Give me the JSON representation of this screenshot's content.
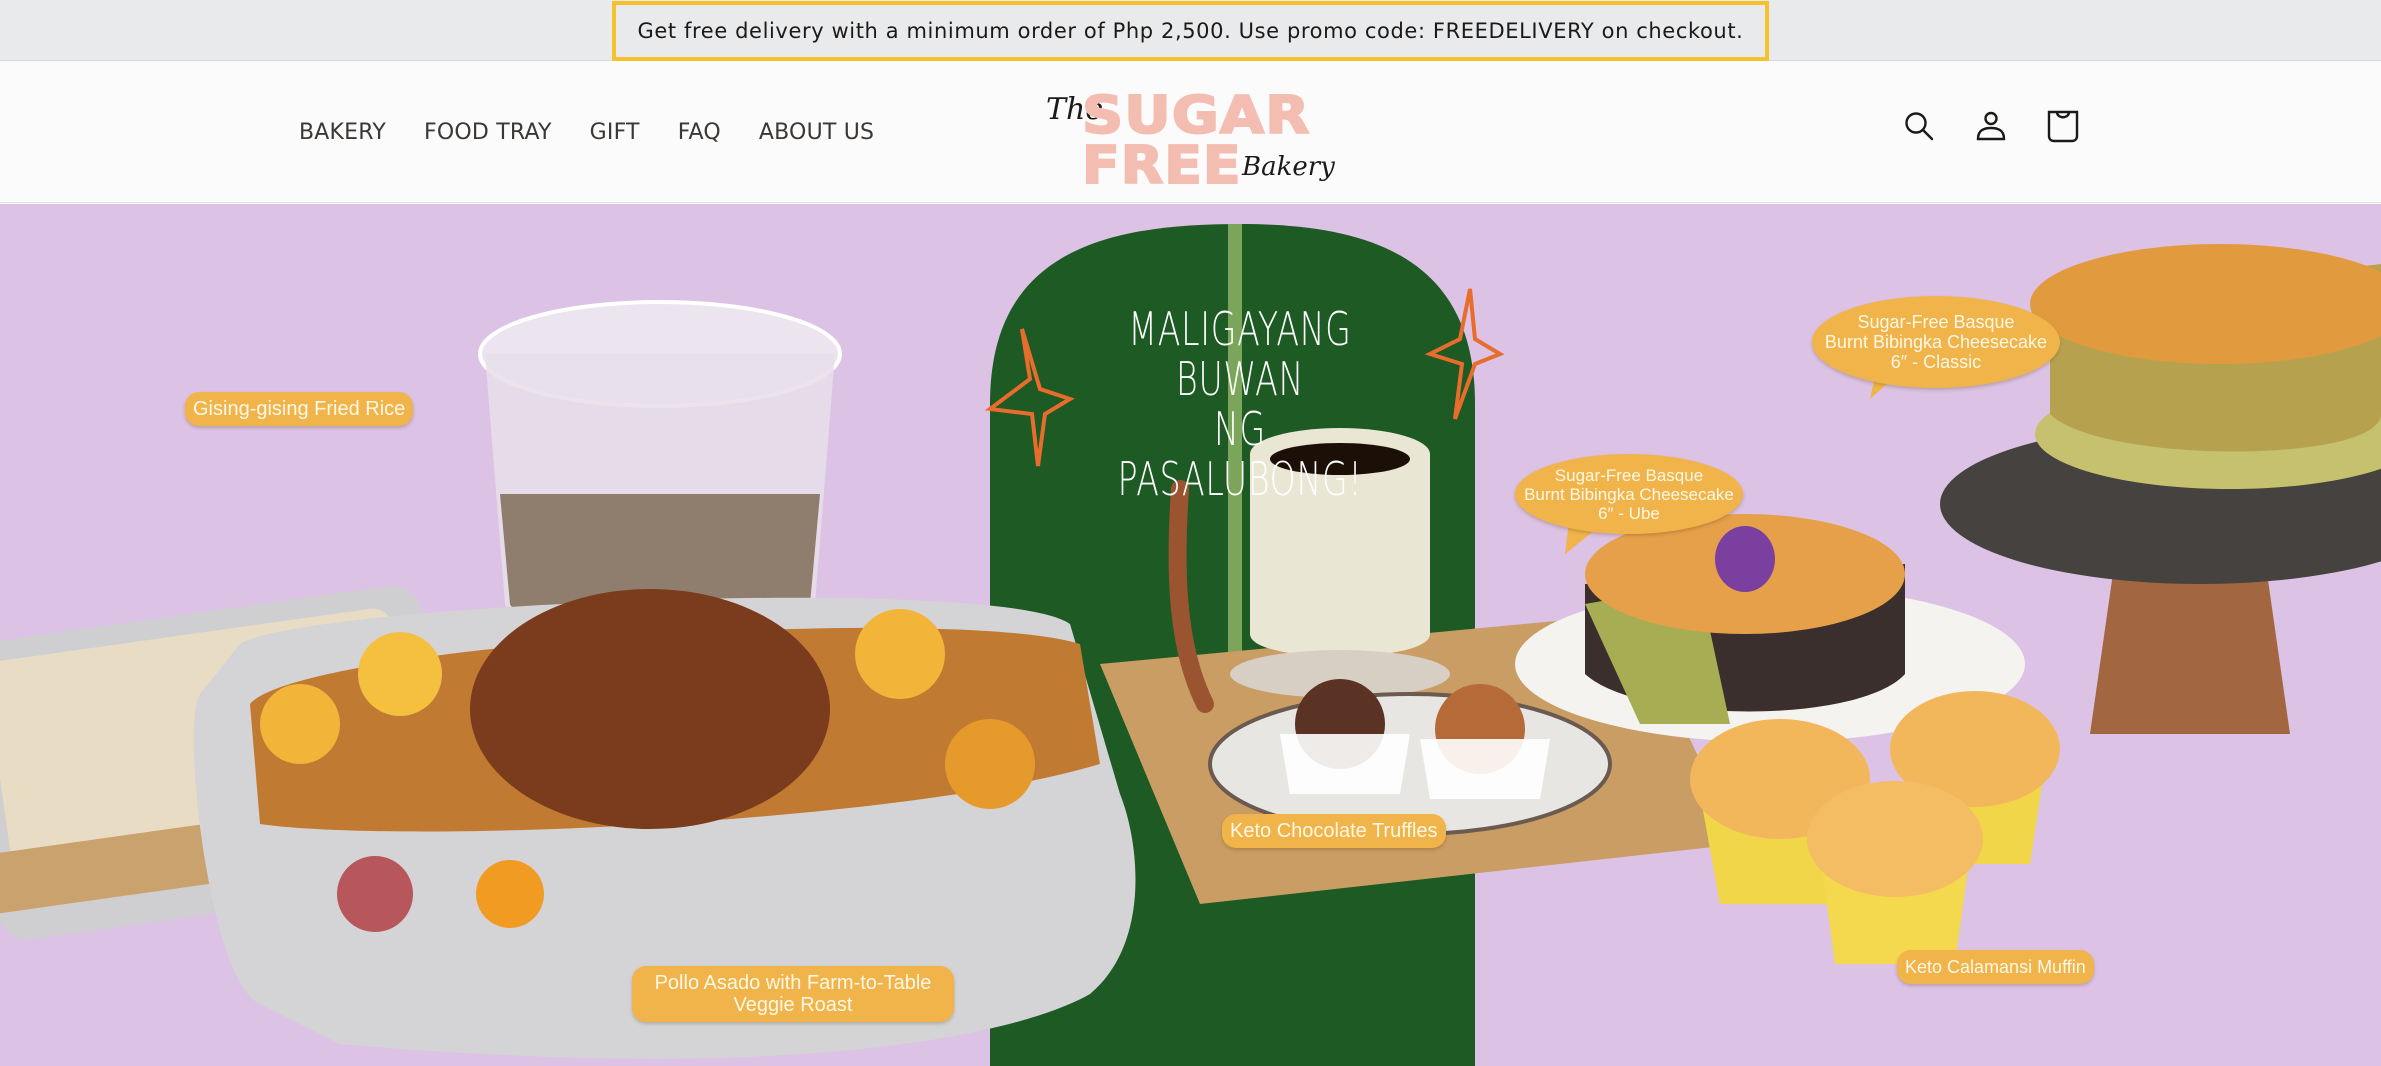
{
  "announcement": {
    "text": "Get free delivery with a minimum order of Php 2,500. Use promo code: FREEDELIVERY on checkout.",
    "border_color": "#f7c12e"
  },
  "header": {
    "nav": [
      {
        "label": "BAKERY"
      },
      {
        "label": "FOOD TRAY"
      },
      {
        "label": "GIFT"
      },
      {
        "label": "FAQ"
      },
      {
        "label": "ABOUT US"
      }
    ],
    "logo": {
      "the": "The",
      "sugar": "SUGAR",
      "free": "FREE",
      "bakery": "Bakery",
      "color": "#f4bdb1"
    },
    "icons": {
      "search": "search-icon",
      "account": "account-icon",
      "cart": "cart-icon"
    }
  },
  "hero": {
    "background_color": "#dcc2e4",
    "headline_line1": "MALIGAYANG BUWAN",
    "headline_line2": "NG PASALUBONG!",
    "tag_color": "#f0b44a",
    "products": [
      {
        "label": "Gising-gising Fried Rice"
      },
      {
        "label_line1": "Pollo Asado with Farm-to-Table",
        "label_line2": "Veggie Roast"
      },
      {
        "label": "Keto Chocolate Truffles"
      },
      {
        "label_line1": "Sugar-Free Basque",
        "label_line2": "Burnt Bibingka Cheesecake",
        "label_line3": "6″ - Ube"
      },
      {
        "label_line1": "Sugar-Free Basque",
        "label_line2": "Burnt Bibingka Cheesecake",
        "label_line3": "6″ - Classic"
      },
      {
        "label": "Keto Calamansi Muffin"
      }
    ]
  }
}
